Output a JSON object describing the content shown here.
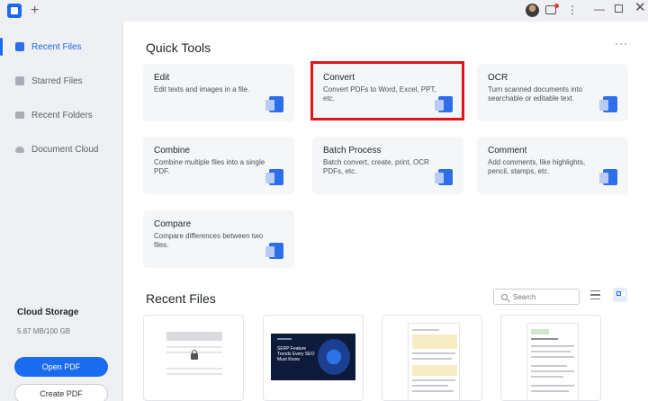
{
  "titlebar": {
    "new_tab": "+",
    "icons": [
      "app-logo-icon",
      "new-tab-icon",
      "avatar",
      "message-icon",
      "kebab-menu-icon",
      "minimize-icon",
      "maximize-icon",
      "close-icon"
    ]
  },
  "sidebar": {
    "items": [
      {
        "label": "Recent Files",
        "icon": "recent-files-icon",
        "active": true
      },
      {
        "label": "Starred Files",
        "icon": "star-icon",
        "active": false
      },
      {
        "label": "Recent Folders",
        "icon": "folder-icon",
        "active": false
      },
      {
        "label": "Document Cloud",
        "icon": "cloud-icon",
        "active": false
      }
    ],
    "cloud_storage": {
      "title": "Cloud Storage",
      "usage": "5.87 MB/100 GB"
    },
    "open_pdf": "Open PDF",
    "create_pdf": "Create PDF"
  },
  "quick_tools": {
    "title": "Quick Tools",
    "more": "···",
    "tools": [
      {
        "title": "Edit",
        "desc": "Edit texts and images in a file."
      },
      {
        "title": "Convert",
        "desc": "Convert PDFs to Word, Excel, PPT, etc."
      },
      {
        "title": "OCR",
        "desc": "Turn scanned documents into searchable or editable text."
      },
      {
        "title": "Combine",
        "desc": "Combine multiple files into a single PDF."
      },
      {
        "title": "Batch Process",
        "desc": "Batch convert, create, print, OCR PDFs, etc."
      },
      {
        "title": "Comment",
        "desc": "Add comments, like highlights, pencil, stamps, etc."
      },
      {
        "title": "Compare",
        "desc": "Compare differences between two files."
      }
    ]
  },
  "recent_files": {
    "title": "Recent Files",
    "search_placeholder": "Search",
    "thumbnail_text": "SERP Feature Trends Every SEO Must Know"
  },
  "colors": {
    "accent": "#1a6bf0",
    "highlight": "#e0141b"
  }
}
